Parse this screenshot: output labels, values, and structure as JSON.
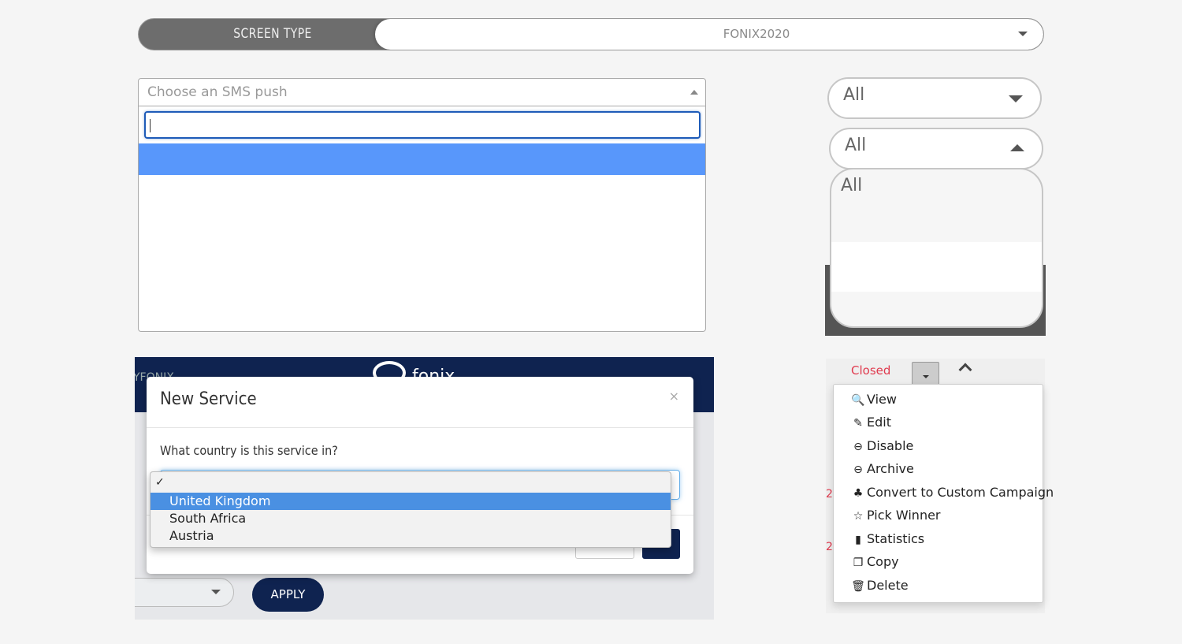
{
  "screen_type": {
    "label": "SCREEN TYPE",
    "value": "FONIX2020"
  },
  "sms_push": {
    "placeholder": "Choose an SMS push",
    "search_value": ""
  },
  "all_select_1": {
    "value": "All"
  },
  "all_select_2": {
    "value": "All",
    "options": [
      "All"
    ]
  },
  "new_service": {
    "header_ghost": "YFONIX",
    "brand": "fonix",
    "title": "New Service",
    "close": "×",
    "question": "What country is this service in?",
    "check": "✓",
    "options": [
      "United Kingdom",
      "South Africa",
      "Austria"
    ],
    "selected": "United Kingdom",
    "apply_label": "APPLY"
  },
  "actions": {
    "status": "Closed",
    "row_marks": [
      "2",
      "2"
    ],
    "items": [
      {
        "label": "View",
        "icon": "search-plus-icon",
        "glyph": "🔍"
      },
      {
        "label": "Edit",
        "icon": "edit-icon",
        "glyph": "✎"
      },
      {
        "label": "Disable",
        "icon": "minus-circle-icon",
        "glyph": "⊖"
      },
      {
        "label": "Archive",
        "icon": "minus-circle-icon",
        "glyph": "⊖"
      },
      {
        "label": "Convert to Custom Campaign",
        "icon": "tree-icon",
        "glyph": "♣"
      },
      {
        "label": "Pick Winner",
        "icon": "star-icon",
        "glyph": "☆"
      },
      {
        "label": "Statistics",
        "icon": "bar-chart-icon",
        "glyph": "▮"
      },
      {
        "label": "Copy",
        "icon": "copy-icon",
        "glyph": "❐"
      },
      {
        "label": "Delete",
        "icon": "trash-icon",
        "glyph": "🗑"
      }
    ]
  }
}
